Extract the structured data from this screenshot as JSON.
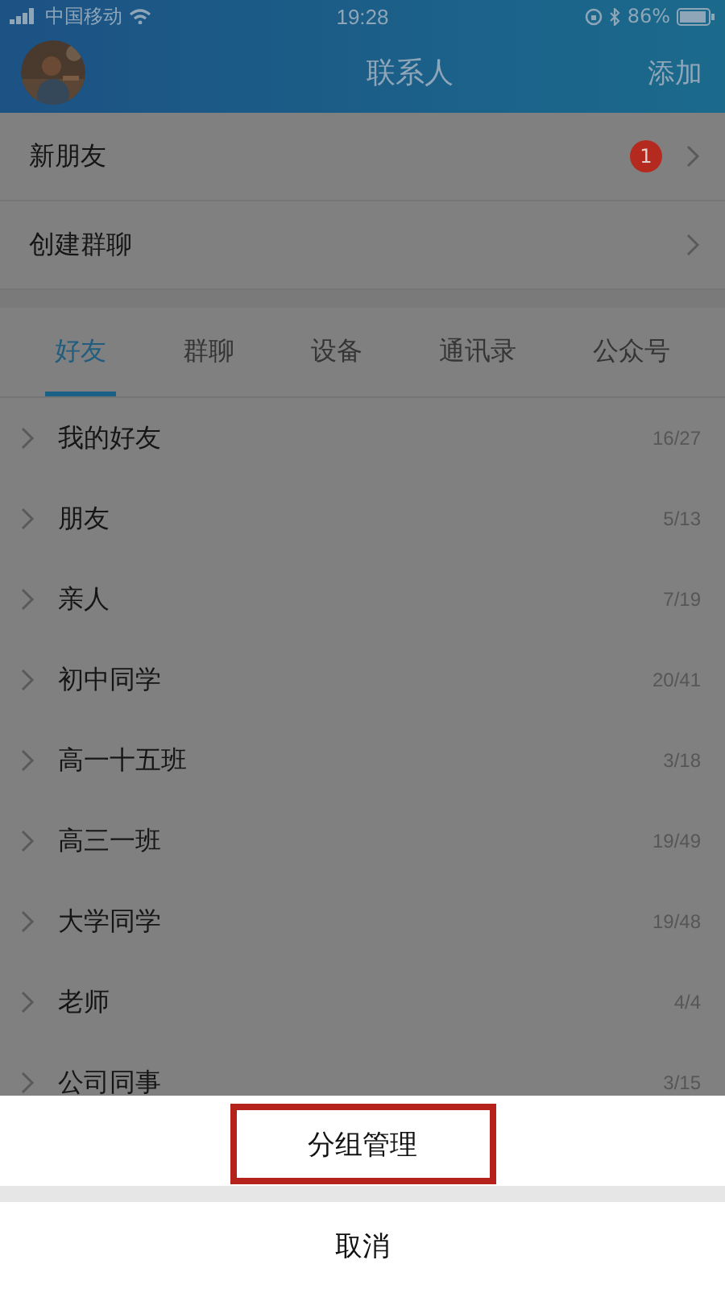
{
  "status_bar": {
    "carrier": "中国移动",
    "time": "19:28",
    "battery": "86%"
  },
  "header": {
    "title": "联系人",
    "action": "添加"
  },
  "entries": [
    {
      "label": "新朋友",
      "badge": "1"
    },
    {
      "label": "创建群聊"
    }
  ],
  "tabs": [
    {
      "label": "好友",
      "selected": true
    },
    {
      "label": "群聊",
      "selected": false
    },
    {
      "label": "设备",
      "selected": false
    },
    {
      "label": "通讯录",
      "selected": false
    },
    {
      "label": "公众号",
      "selected": false
    }
  ],
  "groups": [
    {
      "name": "我的好友",
      "count": "16/27"
    },
    {
      "name": "朋友",
      "count": "5/13"
    },
    {
      "name": "亲人",
      "count": "7/19"
    },
    {
      "name": "初中同学",
      "count": "20/41"
    },
    {
      "name": "高一十五班",
      "count": "3/18"
    },
    {
      "name": "高三一班",
      "count": "19/49"
    },
    {
      "name": "大学同学",
      "count": "19/48"
    },
    {
      "name": "老师",
      "count": "4/4"
    },
    {
      "name": "公司同事",
      "count": "3/15"
    }
  ],
  "action_sheet": {
    "options": [
      {
        "label": "分组管理",
        "highlighted": true
      }
    ],
    "cancel": "取消"
  }
}
